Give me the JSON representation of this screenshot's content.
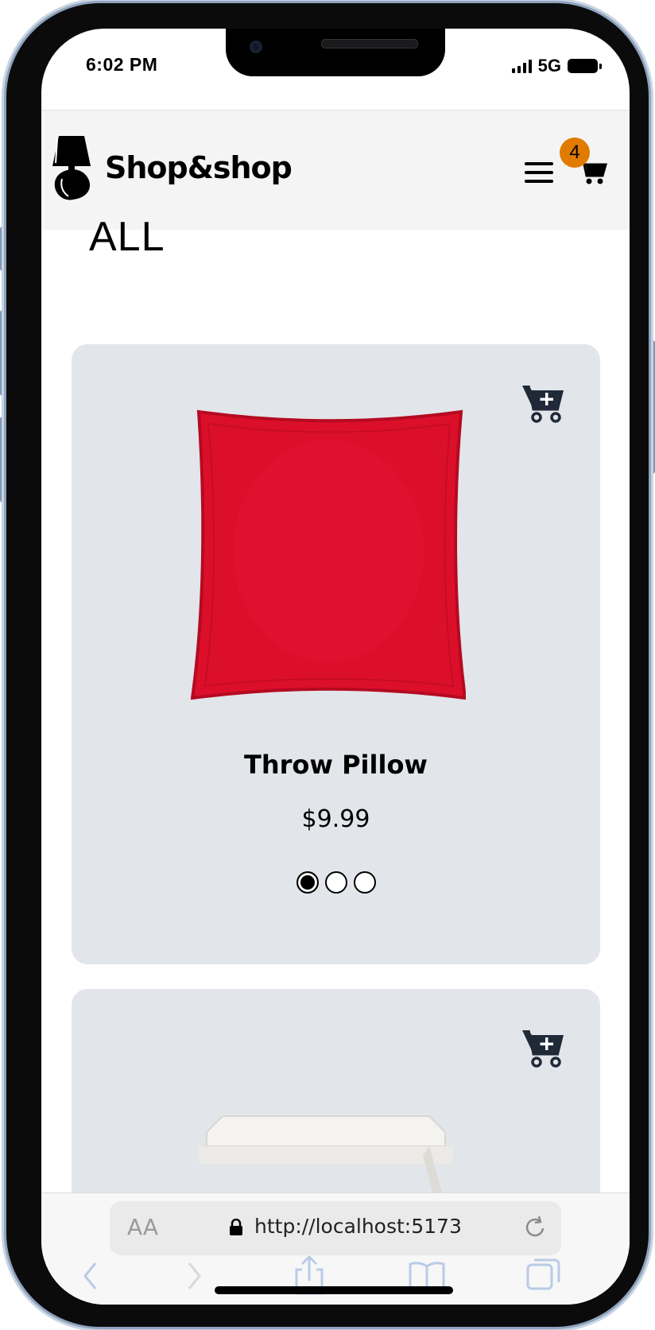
{
  "status_bar": {
    "time": "6:02 PM",
    "network": "5G"
  },
  "header": {
    "brand": "Shop&shop",
    "cart_count": "4"
  },
  "page": {
    "title": "ALL"
  },
  "products": [
    {
      "name": "Throw Pillow",
      "price": "$9.99",
      "image": "red-pillow",
      "color": "#dc0f2a",
      "carousel_active_index": 1,
      "carousel_count": 3
    },
    {
      "name": "",
      "price": "",
      "image": "white-tray-table"
    }
  ],
  "browser": {
    "text_size_label": "AA",
    "url": "http://localhost:5173"
  },
  "colors": {
    "accent": "#e07b00",
    "card_bg": "#e2e5ea",
    "cart_icon": "#1f2937"
  }
}
